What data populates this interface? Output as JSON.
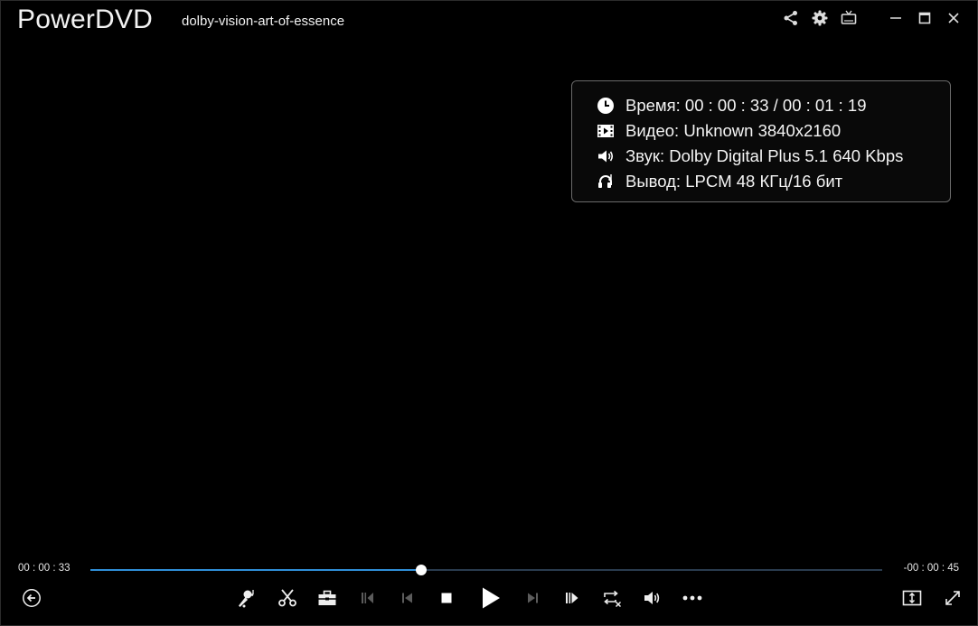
{
  "header": {
    "app_title": "PowerDVD",
    "file_title": "dolby-vision-art-of-essence"
  },
  "top_icons": [
    "share-icon",
    "gear-icon",
    "tv-mode-icon",
    "minimize-icon",
    "maximize-icon",
    "close-icon"
  ],
  "info": {
    "time": "Время: 00 : 00 : 33 / 00 : 01 : 19",
    "video": "Видео: Unknown 3840x2160",
    "audio": "Звук: Dolby Digital Plus 5.1  640 Kbps",
    "output": "Вывод: LPCM 48 КГц/16 бит"
  },
  "playback": {
    "elapsed": "00 : 00 : 33",
    "remaining": "-00 : 00 : 45",
    "progress": 0.418
  },
  "colors": {
    "accent": "#2f8fd8",
    "background": "#000000",
    "disabled": "#5c5c5c"
  },
  "controls": [
    "back-icon",
    "karaoke-icon",
    "scissors-icon",
    "toolbox-icon",
    "step-back-frame-icon",
    "previous-icon",
    "stop-icon",
    "play-icon",
    "next-icon",
    "step-forward-frame-icon",
    "repeat-off-icon",
    "volume-icon",
    "more-icon",
    "aspect-ratio-icon",
    "fullscreen-icon"
  ]
}
